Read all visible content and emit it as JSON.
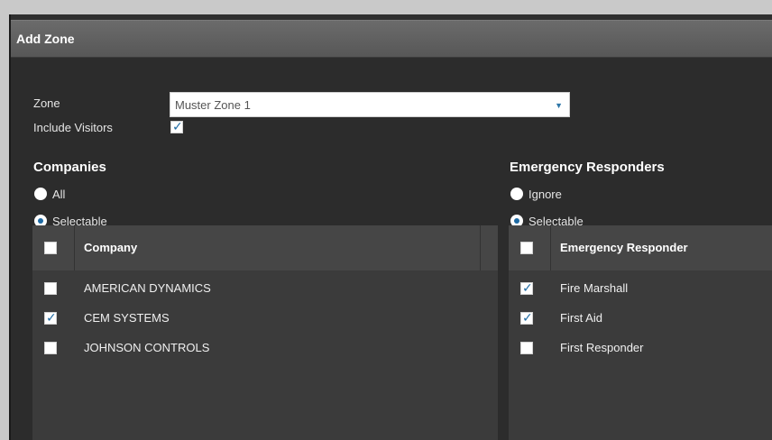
{
  "window": {
    "title": "Add Zone"
  },
  "form": {
    "zone_label": "Zone",
    "zone_value": "Muster Zone 1",
    "include_visitors_label": "Include Visitors",
    "include_visitors_checked": true
  },
  "companies": {
    "title": "Companies",
    "radio_options": [
      {
        "label": "All",
        "selected": false
      },
      {
        "label": "Selectable",
        "selected": true
      }
    ],
    "column_header": "Company",
    "rows": [
      {
        "label": "AMERICAN DYNAMICS",
        "checked": false
      },
      {
        "label": "CEM SYSTEMS",
        "checked": true
      },
      {
        "label": "JOHNSON CONTROLS",
        "checked": false
      }
    ]
  },
  "responders": {
    "title": "Emergency Responders",
    "radio_options": [
      {
        "label": "Ignore",
        "selected": false
      },
      {
        "label": "Selectable",
        "selected": true
      }
    ],
    "column_header": "Emergency Responder",
    "rows": [
      {
        "label": "Fire Marshall",
        "checked": true
      },
      {
        "label": "First Aid",
        "checked": true
      },
      {
        "label": "First Responder",
        "checked": false
      }
    ]
  },
  "icons": {
    "checkmark": "check-icon",
    "dropdown": "caret-down-icon"
  },
  "colors": {
    "accent": "#1e6aa3",
    "background": "#2c2c2c",
    "titlebar": "#606060"
  }
}
